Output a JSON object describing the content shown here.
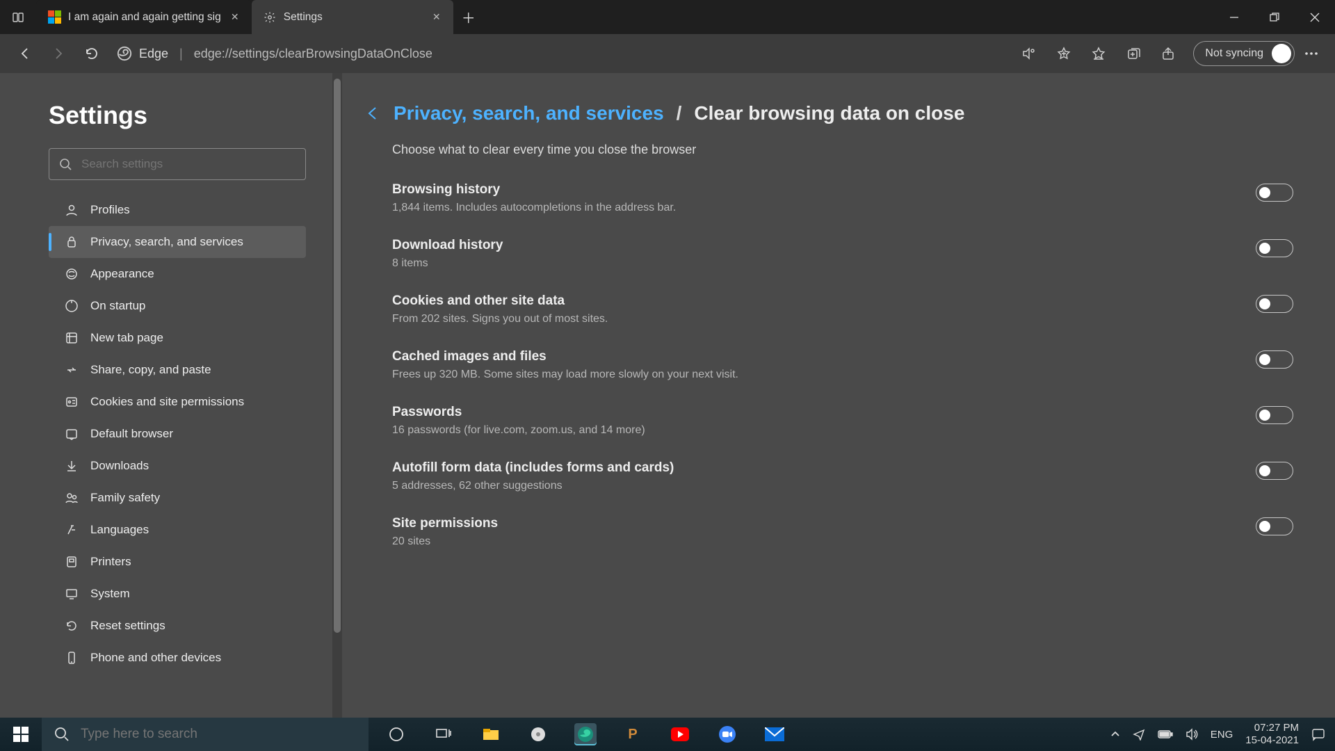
{
  "tabs": [
    {
      "label": "I am again and again getting sig",
      "active": false
    },
    {
      "label": "Settings",
      "active": true
    }
  ],
  "toolbar": {
    "edge_label": "Edge",
    "url": "edge://settings/clearBrowsingDataOnClose",
    "sync_label": "Not syncing"
  },
  "sidebar": {
    "title": "Settings",
    "search_placeholder": "Search settings",
    "items": [
      {
        "label": "Profiles"
      },
      {
        "label": "Privacy, search, and services"
      },
      {
        "label": "Appearance"
      },
      {
        "label": "On startup"
      },
      {
        "label": "New tab page"
      },
      {
        "label": "Share, copy, and paste"
      },
      {
        "label": "Cookies and site permissions"
      },
      {
        "label": "Default browser"
      },
      {
        "label": "Downloads"
      },
      {
        "label": "Family safety"
      },
      {
        "label": "Languages"
      },
      {
        "label": "Printers"
      },
      {
        "label": "System"
      },
      {
        "label": "Reset settings"
      },
      {
        "label": "Phone and other devices"
      }
    ],
    "active_index": 1
  },
  "main": {
    "breadcrumb_link": "Privacy, search, and services",
    "breadcrumb_sep": "/",
    "breadcrumb_current": "Clear browsing data on close",
    "subtitle": "Choose what to clear every time you close the browser",
    "items": [
      {
        "title": "Browsing history",
        "desc": "1,844 items. Includes autocompletions in the address bar.",
        "on": false
      },
      {
        "title": "Download history",
        "desc": "8 items",
        "on": false
      },
      {
        "title": "Cookies and other site data",
        "desc": "From 202 sites. Signs you out of most sites.",
        "on": false
      },
      {
        "title": "Cached images and files",
        "desc": "Frees up 320 MB. Some sites may load more slowly on your next visit.",
        "on": false
      },
      {
        "title": "Passwords",
        "desc": "16 passwords (for live.com, zoom.us, and 14 more)",
        "on": false
      },
      {
        "title": "Autofill form data (includes forms and cards)",
        "desc": "5 addresses, 62 other suggestions",
        "on": false
      },
      {
        "title": "Site permissions",
        "desc": "20 sites",
        "on": false
      }
    ]
  },
  "taskbar": {
    "search_placeholder": "Type here to search",
    "lang": "ENG",
    "time": "07:27 PM",
    "date": "15-04-2021"
  }
}
